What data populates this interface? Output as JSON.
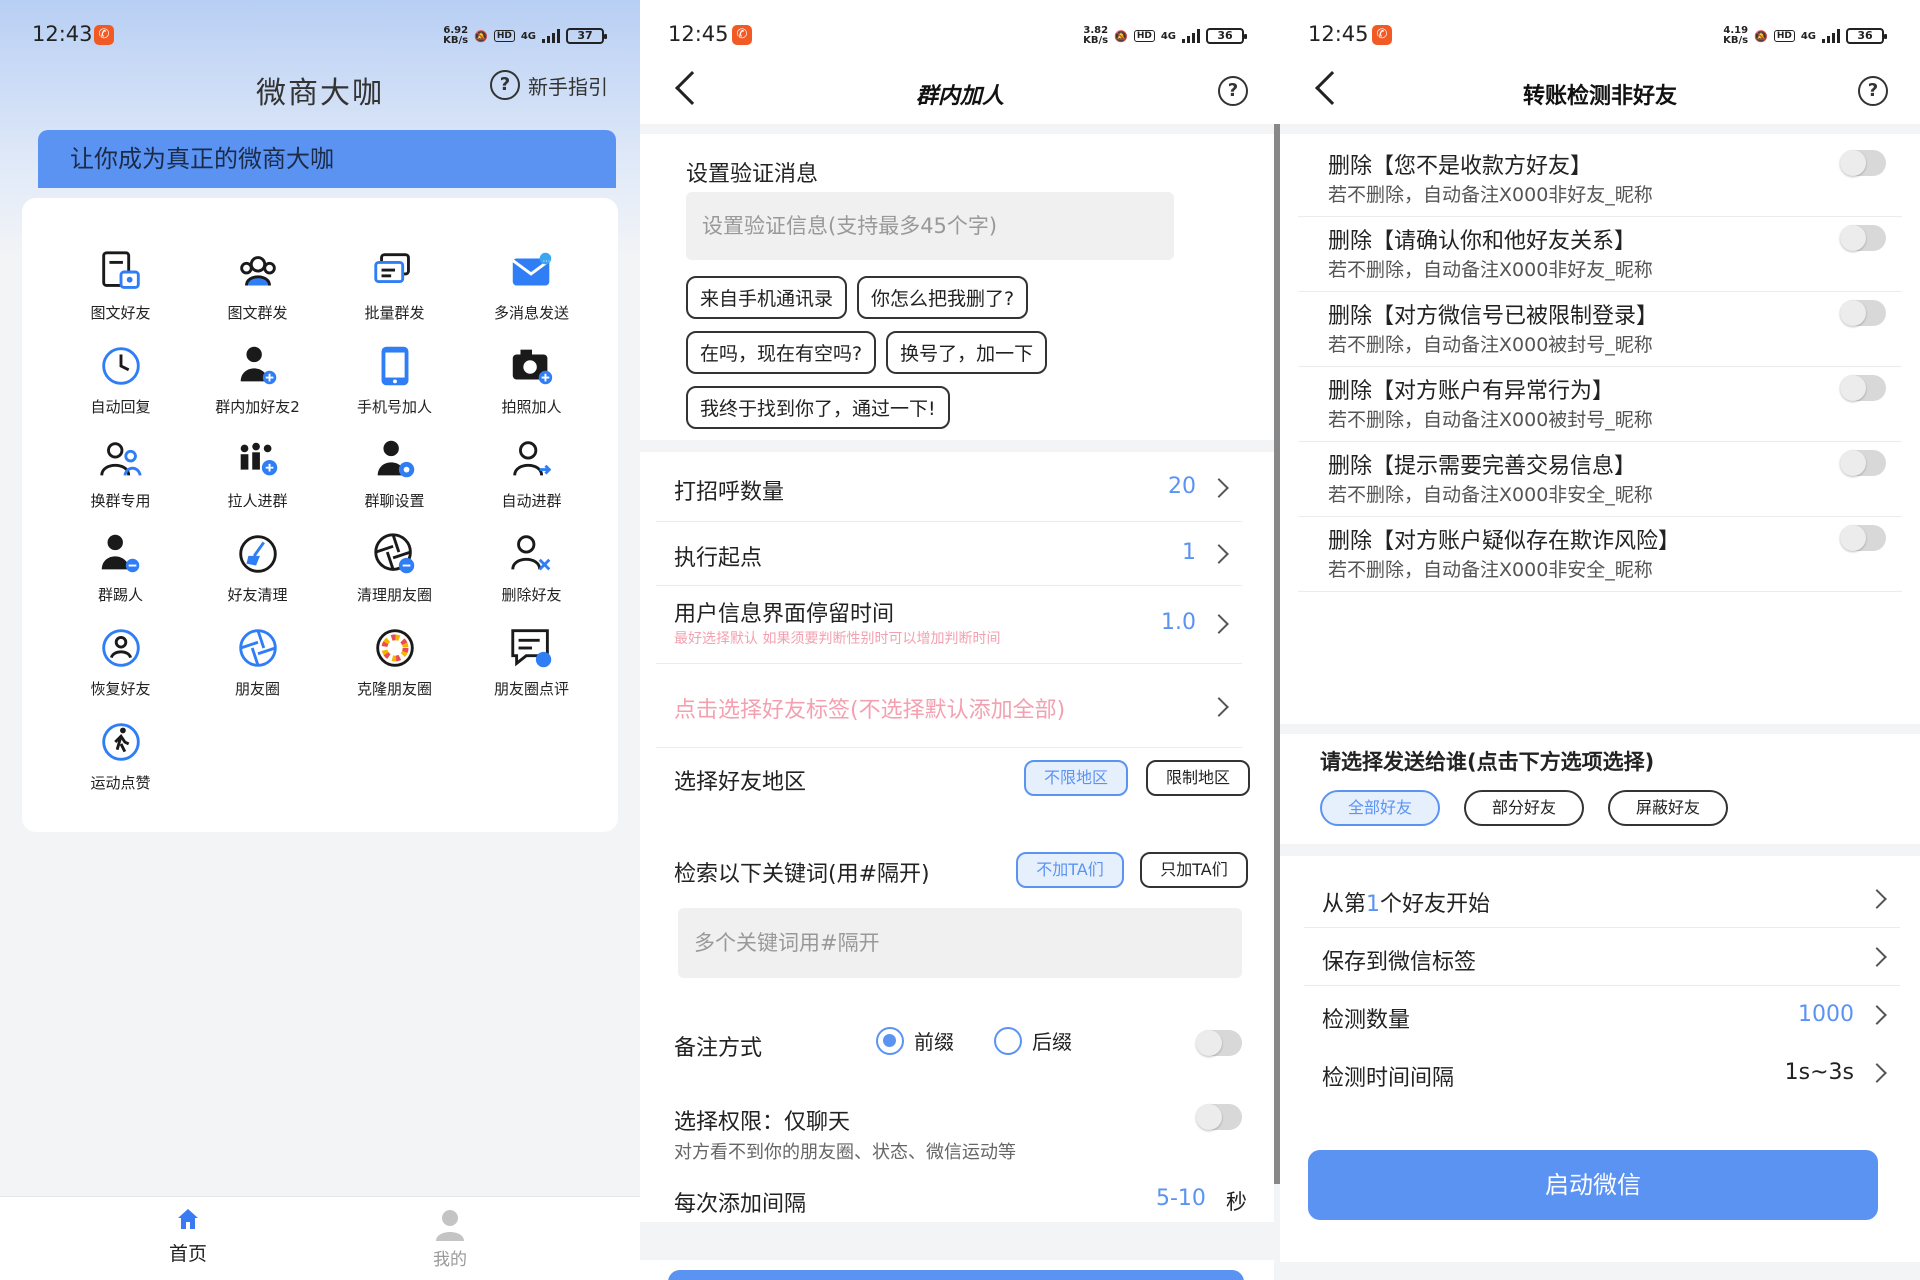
{
  "panels": [
    {
      "status": {
        "time": "12:43",
        "speed_top": "6.92",
        "speed_bottom": "KB/s",
        "network": "4G",
        "battery": "37"
      },
      "title": "微商大咖",
      "guide_label": "新手指引",
      "slogan": "让你成为真正的微商大咖",
      "features": [
        {
          "label": "图文好友",
          "icon": "doc-image-icon"
        },
        {
          "label": "图文群发",
          "icon": "group-icon"
        },
        {
          "label": "批量群发",
          "icon": "chat-stack-icon"
        },
        {
          "label": "多消息发送",
          "icon": "envelope-icon"
        },
        {
          "label": "自动回复",
          "icon": "clock-icon"
        },
        {
          "label": "群内加好友2",
          "icon": "user-add-icon"
        },
        {
          "label": "手机号加人",
          "icon": "phone-icon"
        },
        {
          "label": "拍照加人",
          "icon": "camera-icon"
        },
        {
          "label": "换群专用",
          "icon": "users-icon"
        },
        {
          "label": "拉人进群",
          "icon": "people-add-icon"
        },
        {
          "label": "群聊设置",
          "icon": "user-gear-icon"
        },
        {
          "label": "自动进群",
          "icon": "user-arrow-icon"
        },
        {
          "label": "群踢人",
          "icon": "user-remove-icon"
        },
        {
          "label": "好友清理",
          "icon": "broom-icon"
        },
        {
          "label": "清理朋友圈",
          "icon": "aperture-minus-icon"
        },
        {
          "label": "删除好友",
          "icon": "user-delete-icon"
        },
        {
          "label": "恢复好友",
          "icon": "user-restore-icon"
        },
        {
          "label": "朋友圈",
          "icon": "aperture-icon"
        },
        {
          "label": "克隆朋友圈",
          "icon": "color-aperture-icon"
        },
        {
          "label": "朋友圈点评",
          "icon": "comment-icon"
        },
        {
          "label": "运动点赞",
          "icon": "run-icon"
        }
      ],
      "nav": {
        "home": "首页",
        "mine": "我的"
      }
    },
    {
      "status": {
        "time": "12:45",
        "speed_top": "3.82",
        "speed_bottom": "KB/s",
        "network": "4G",
        "battery": "36"
      },
      "title": "群内加人",
      "verify": {
        "title": "设置验证消息",
        "placeholder": "设置验证信息(支持最多45个字)",
        "chips": [
          "来自手机通讯录",
          "你怎么把我删了?",
          "在吗，现在有空吗?",
          "换号了，加一下",
          "我终于找到你了，通过一下!"
        ]
      },
      "rows": {
        "greet_label": "打招呼数量",
        "greet_value": "20",
        "start_label": "执行起点",
        "start_value": "1",
        "stay_label": "用户信息界面停留时间",
        "stay_value": "1.0",
        "stay_hint": "最好选择默认 如果须要判断性别时可以增加判断时间",
        "tag_label": "点击选择好友标签(不选择默认添加全部)",
        "region_label": "选择好友地区",
        "region_opt1": "不限地区",
        "region_opt2": "限制地区",
        "keyword_label": "检索以下关键词(用#隔开)",
        "keyword_opt1": "不加TA们",
        "keyword_opt2": "只加TA们",
        "keyword_placeholder": "多个关键词用#隔开",
        "remark_label": "备注方式",
        "remark_prefix": "前缀",
        "remark_suffix": "后缀",
        "perm_label": "选择权限：仅聊天",
        "perm_sub": "对方看不到你的朋友圈、状态、微信运动等",
        "interval_label": "每次添加间隔",
        "interval_value": "5-10",
        "interval_unit": "秒"
      }
    },
    {
      "status": {
        "time": "12:45",
        "speed_top": "4.19",
        "speed_bottom": "KB/s",
        "network": "4G",
        "battery": "36"
      },
      "title": "转账检测非好友",
      "delete_items": [
        {
          "title": "删除【您不是收款方好友】",
          "sub": "若不删除，自动备注X000非好友_昵称"
        },
        {
          "title": "删除【请确认你和他好友关系】",
          "sub": "若不删除，自动备注X000非好友_昵称"
        },
        {
          "title": "删除【对方微信号已被限制登录】",
          "sub": "若不删除，自动备注X000被封号_昵称"
        },
        {
          "title": "删除【对方账户有异常行为】",
          "sub": "若不删除，自动备注X000被封号_昵称"
        },
        {
          "title": "删除【提示需要完善交易信息】",
          "sub": "若不删除，自动备注X000非安全_昵称"
        },
        {
          "title": "删除【对方账户疑似存在欺诈风险】",
          "sub": "若不删除，自动备注X000非安全_昵称"
        }
      ],
      "send_title": "请选择发送给谁(点击下方选项选择)",
      "send_opts": [
        "全部好友",
        "部分好友",
        "屏蔽好友"
      ],
      "start_from_prefix": "从第",
      "start_from_num": "1",
      "start_from_suffix": "个好友开始",
      "save_tag": "保存到微信标签",
      "count_label": "检测数量",
      "count_value": "1000",
      "interval_label": "检测时间间隔",
      "interval_value": "1s~3s",
      "start_button": "启动微信"
    }
  ],
  "colors": {
    "accent": "#5b93f3",
    "hint": "#f4a0b0",
    "badge": "#f15a24"
  }
}
